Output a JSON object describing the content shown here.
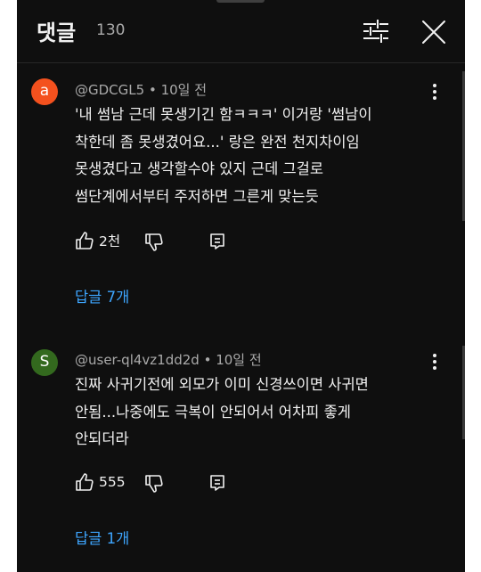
{
  "header": {
    "title": "댓글",
    "count": "130",
    "filter_icon": "filter-sliders-icon",
    "close_icon": "close-icon"
  },
  "comments": [
    {
      "avatar_letter": "a",
      "avatar_color": "#f4511e",
      "author": "@GDCGL5",
      "time": "10일 전",
      "text_lines": [
        "'내 썸남 근데 못생기긴 함ㅋㅋㅋ' 이거랑 '썸남이",
        "착한데 좀 못생겼어요...' 랑은 완전 천지차이임",
        "못생겼다고 생각할수야 있지 근데 그걸로",
        "썸단계에서부터 주저하면 그른게 맞는듯"
      ],
      "likes": "2천",
      "replies": "답글 7개"
    },
    {
      "avatar_letter": "S",
      "avatar_color": "#33691e",
      "author": "@user-ql4vz1dd2d",
      "time": "10일 전",
      "text_lines": [
        "진짜 사귀기전에 외모가 이미 신경쓰이면 사귀면",
        "안됨...나중에도 극복이 안되어서 어차피 좋게",
        "안되더라"
      ],
      "likes": "555",
      "replies": "답글 1개"
    }
  ],
  "colors": {
    "background": "#0f0f0f",
    "text": "#f1f1f1",
    "secondary_text": "#aaaaaa",
    "link": "#3ea6ff"
  }
}
